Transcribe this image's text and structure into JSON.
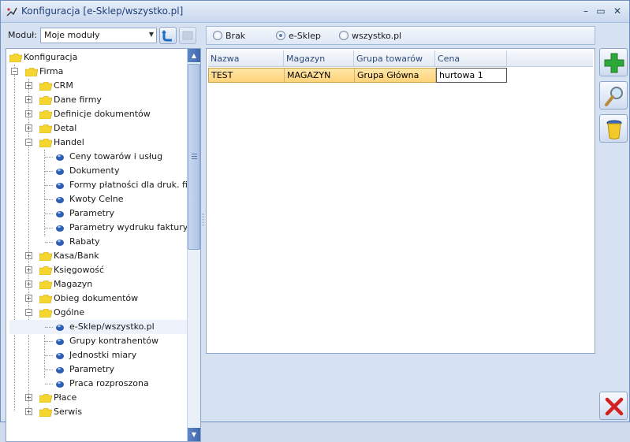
{
  "window": {
    "title": "Konfiguracja [e-Sklep/wszystko.pl]",
    "controls": {
      "minimize": "–",
      "maximize": "▭",
      "close": "✕"
    }
  },
  "module": {
    "label": "Moduł:",
    "selected": "Moje moduły"
  },
  "tree": {
    "root": "Konfiguracja",
    "items": [
      {
        "label": "Firma"
      },
      {
        "label": "CRM"
      },
      {
        "label": "Dane firmy"
      },
      {
        "label": "Definicje dokumentów"
      },
      {
        "label": "Detal"
      },
      {
        "label": "Handel"
      },
      {
        "label": "Ceny towarów i usług"
      },
      {
        "label": "Dokumenty"
      },
      {
        "label": "Formy płatności dla druk. fisk."
      },
      {
        "label": "Kwoty Celne"
      },
      {
        "label": "Parametry"
      },
      {
        "label": "Parametry wydruku faktury"
      },
      {
        "label": "Rabaty"
      },
      {
        "label": "Kasa/Bank"
      },
      {
        "label": "Księgowość"
      },
      {
        "label": "Magazyn"
      },
      {
        "label": "Obieg dokumentów"
      },
      {
        "label": "Ogólne"
      },
      {
        "label": "e-Sklep/wszystko.pl"
      },
      {
        "label": "Grupy kontrahentów"
      },
      {
        "label": "Jednostki miary"
      },
      {
        "label": "Parametry"
      },
      {
        "label": "Praca rozproszona"
      },
      {
        "label": "Płace"
      },
      {
        "label": "Serwis"
      }
    ]
  },
  "filter": {
    "options": [
      {
        "label": "Brak",
        "selected": false
      },
      {
        "label": "e-Sklep",
        "selected": true
      },
      {
        "label": "wszystko.pl",
        "selected": false
      }
    ]
  },
  "grid": {
    "columns": [
      "Nazwa",
      "Magazyn",
      "Grupa towarów",
      "Cena"
    ],
    "rows": [
      [
        "TEST",
        "MAGAZYN",
        "Grupa Główna",
        "hurtowa 1"
      ]
    ]
  },
  "colors": {
    "accent": "#1f3f78",
    "selected_row": "#ffd27a",
    "add_icon": "#2fa83a",
    "close_icon": "#d42020"
  }
}
